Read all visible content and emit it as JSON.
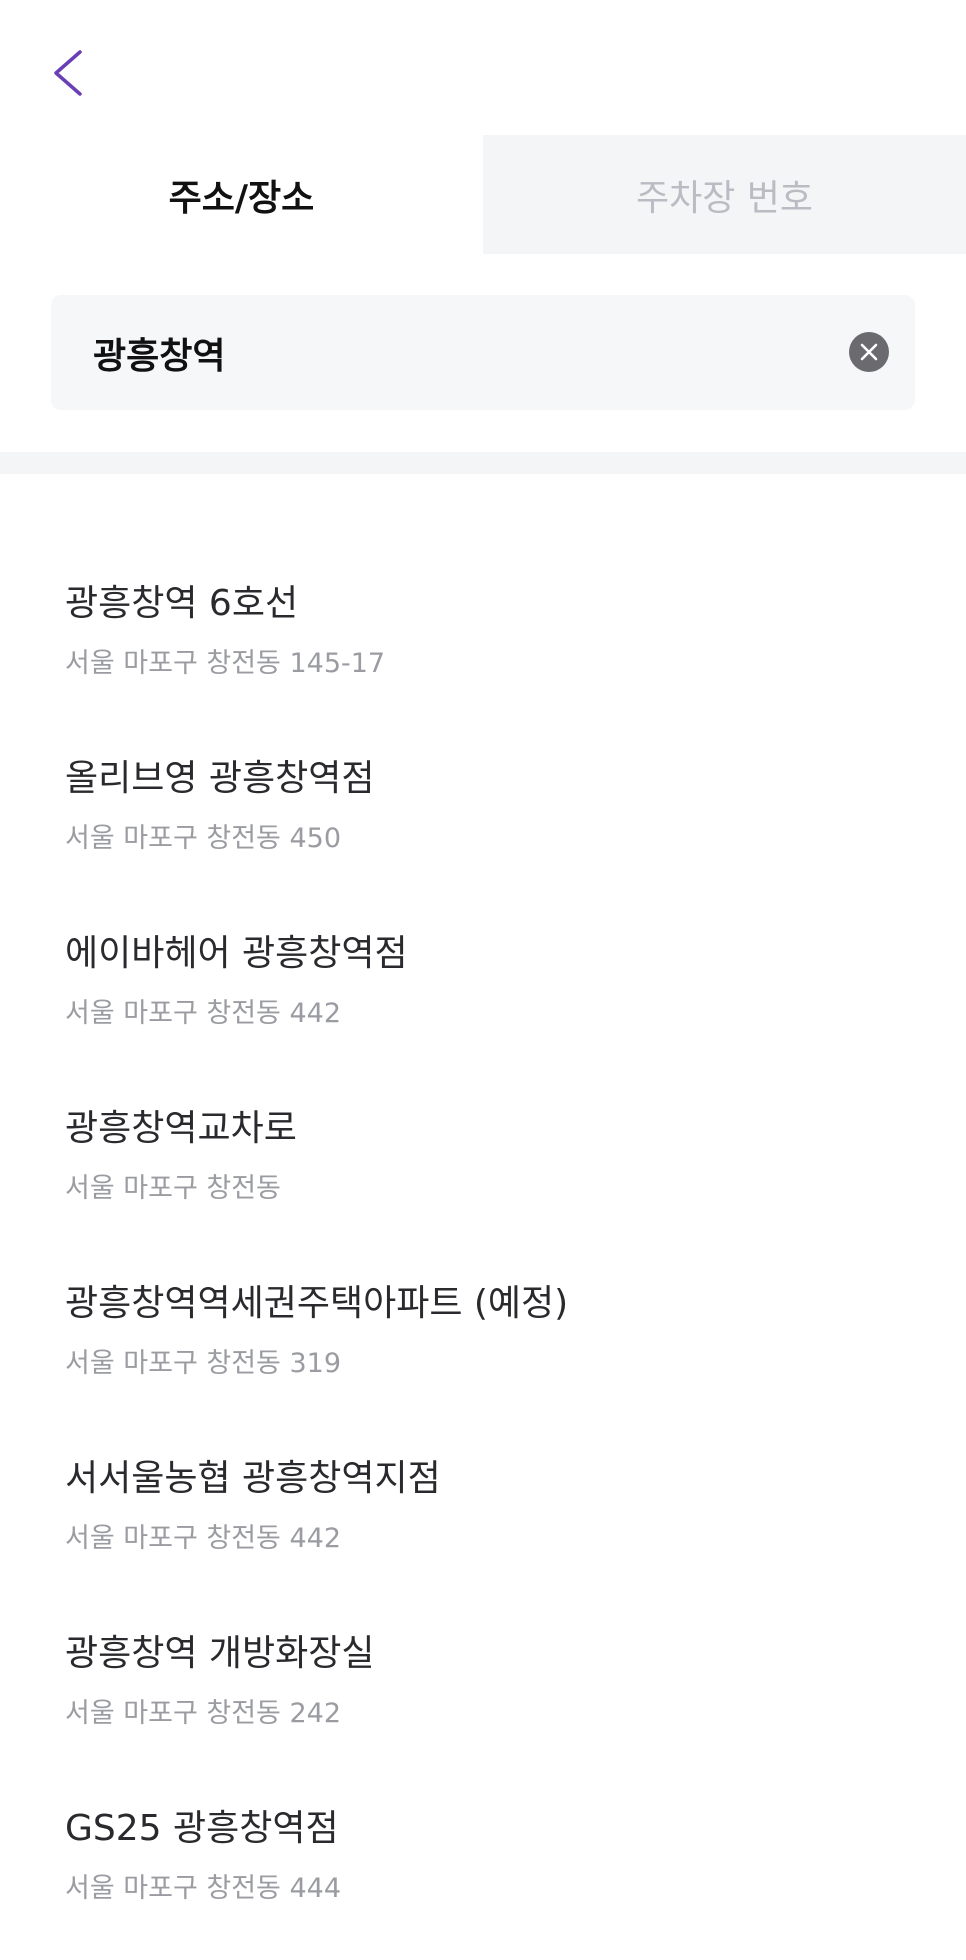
{
  "colors": {
    "accent": "#6a3fb5",
    "tab_inactive_bg": "#f4f5f7",
    "tab_inactive_text": "#b9bcc2",
    "address_text": "#9a9ca1"
  },
  "header": {
    "back_icon": "chevron-left-icon"
  },
  "tabs": [
    {
      "label": "주소/장소",
      "active": true
    },
    {
      "label": "주차장 번호",
      "active": false
    }
  ],
  "search": {
    "value": "광흥창역",
    "clear_icon": "close-circle-icon"
  },
  "results": [
    {
      "name": "광흥창역 6호선",
      "address": "서울 마포구 창전동 145-17"
    },
    {
      "name": "올리브영 광흥창역점",
      "address": "서울 마포구 창전동 450"
    },
    {
      "name": "에이바헤어 광흥창역점",
      "address": "서울 마포구 창전동 442"
    },
    {
      "name": "광흥창역교차로",
      "address": "서울 마포구 창전동"
    },
    {
      "name": "광흥창역역세권주택아파트 (예정)",
      "address": "서울 마포구 창전동 319"
    },
    {
      "name": "서서울농협 광흥창역지점",
      "address": "서울 마포구 창전동 442"
    },
    {
      "name": "광흥창역 개방화장실",
      "address": "서울 마포구 창전동 242"
    },
    {
      "name": "GS25 광흥창역점",
      "address": "서울 마포구 창전동 444"
    }
  ]
}
